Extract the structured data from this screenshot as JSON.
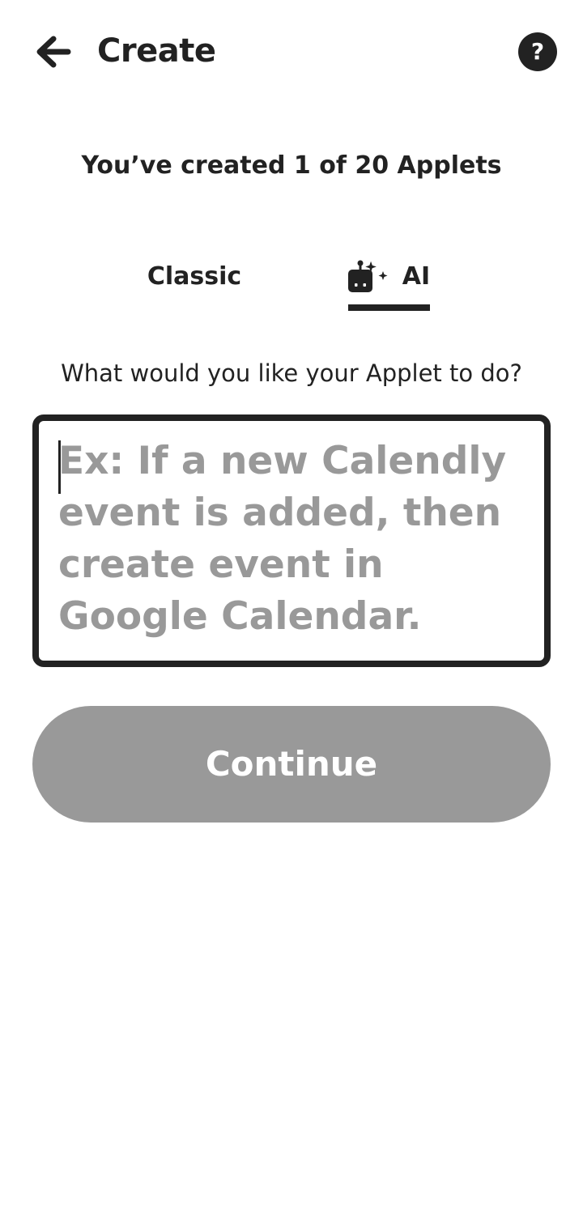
{
  "header": {
    "title": "Create",
    "back_icon": "arrow-left-icon",
    "help_icon": "help-icon",
    "help_glyph": "?"
  },
  "applet_count_text": "You’ve created 1 of 20 Applets",
  "tabs": [
    {
      "label": "Classic",
      "selected": false
    },
    {
      "label": "AI",
      "selected": true,
      "icon": "ai-robot-icon"
    }
  ],
  "prompt": {
    "label": "What would you like your Applet to do?",
    "value": "",
    "placeholder": "Ex: If a new Calendly event is added, then create event in Google Calendar."
  },
  "continue_button": {
    "label": "Continue",
    "enabled": false
  },
  "colors": {
    "text": "#222222",
    "disabled": "#999999",
    "background": "#ffffff"
  }
}
